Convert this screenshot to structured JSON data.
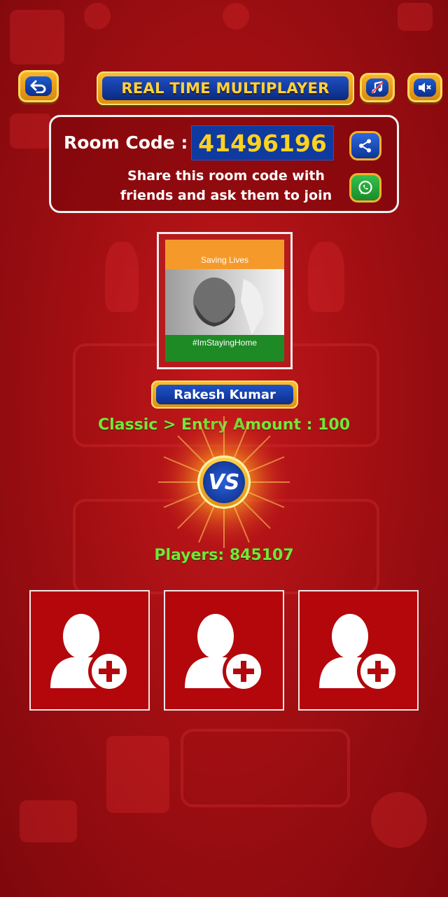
{
  "header": {
    "title": "REAL TIME MULTIPLAYER",
    "back_icon": "back-arrow-icon",
    "music_icon": "music-off-icon",
    "sound_icon": "sound-mute-icon"
  },
  "room": {
    "label": "Room Code :",
    "code": "41496196",
    "share_text_line1": "Share this room code with",
    "share_text_line2": "friends and ask them to join",
    "share_icon": "share-icon",
    "whatsapp_icon": "whatsapp-icon"
  },
  "player": {
    "avatar_top_text": "Saving Lives",
    "avatar_bottom_text": "#ImStayingHome",
    "name": "Rakesh Kumar"
  },
  "game": {
    "mode_text": "Classic > Entry Amount : 100",
    "vs_label": "VS",
    "players_text": "Players: 845107"
  },
  "slots": [
    {
      "icon": "add-player-icon"
    },
    {
      "icon": "add-player-icon"
    },
    {
      "icon": "add-player-icon"
    }
  ],
  "colors": {
    "background": "#a30f13",
    "accent_gold": "#f7b528",
    "accent_blue": "#0f3aa0",
    "green_text": "#6fe83a",
    "slot_red": "#b3070c"
  }
}
